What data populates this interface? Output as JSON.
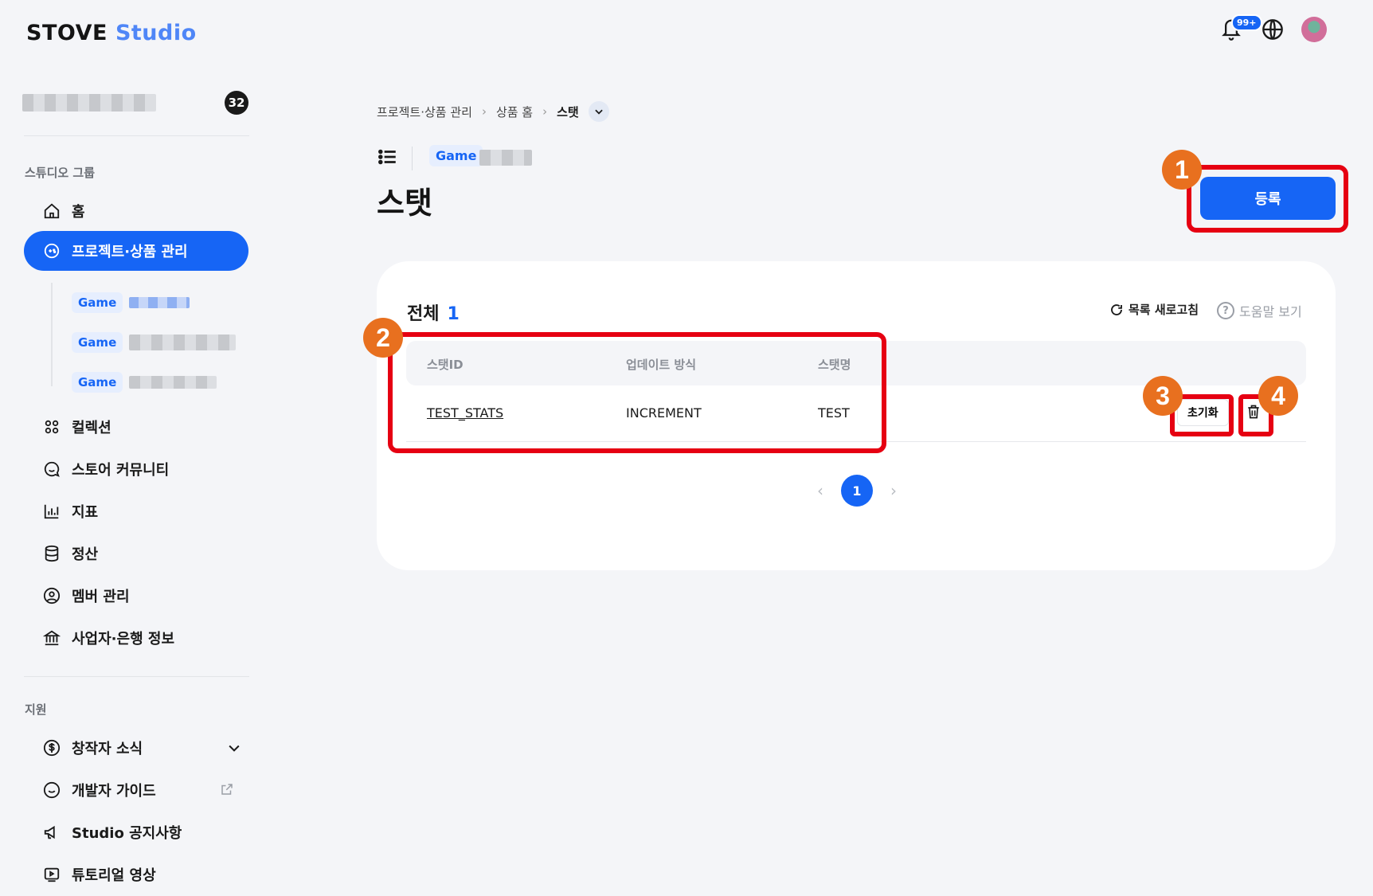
{
  "header": {
    "logo_stove": "STOVE",
    "logo_studio": "Studio",
    "notif_badge": "99+"
  },
  "sidebar": {
    "studio_count": "32",
    "group_label": "스튜디오 그룹",
    "items": [
      {
        "label": "홈"
      },
      {
        "label": "프로젝트·상품 관리"
      },
      {
        "label": "컬렉션"
      },
      {
        "label": "스토어 커뮤니티"
      },
      {
        "label": "지표"
      },
      {
        "label": "정산"
      },
      {
        "label": "멤버 관리"
      },
      {
        "label": "사업자·은행 정보"
      }
    ],
    "sub_items": [
      {
        "tag": "Game"
      },
      {
        "tag": "Game"
      },
      {
        "tag": "Game"
      }
    ],
    "support_label": "지원",
    "support_items": [
      {
        "label": "창작자 소식"
      },
      {
        "label": "개발자 가이드"
      },
      {
        "label": "Studio 공지사항"
      },
      {
        "label": "튜토리얼 영상"
      }
    ]
  },
  "breadcrumb": [
    "프로젝트·상품 관리",
    "상품 홈",
    "스탯"
  ],
  "page": {
    "game_tag": "Game",
    "title": "스탯",
    "register_label": "등록"
  },
  "list": {
    "total_label": "전체",
    "total_count": "1",
    "refresh_label": "목록 새로고침",
    "help_label": "도움말 보기",
    "columns": [
      "스탯ID",
      "업데이트 방식",
      "스탯명"
    ],
    "rows": [
      {
        "id": "TEST_STATS",
        "method": "INCREMENT",
        "name": "TEST"
      }
    ],
    "reset_label": "초기화",
    "current_page": "1"
  },
  "markers": [
    "1",
    "2",
    "3",
    "4"
  ],
  "colors": {
    "accent": "#1665f5",
    "highlight": "#e60012",
    "marker": "#e8701f"
  }
}
